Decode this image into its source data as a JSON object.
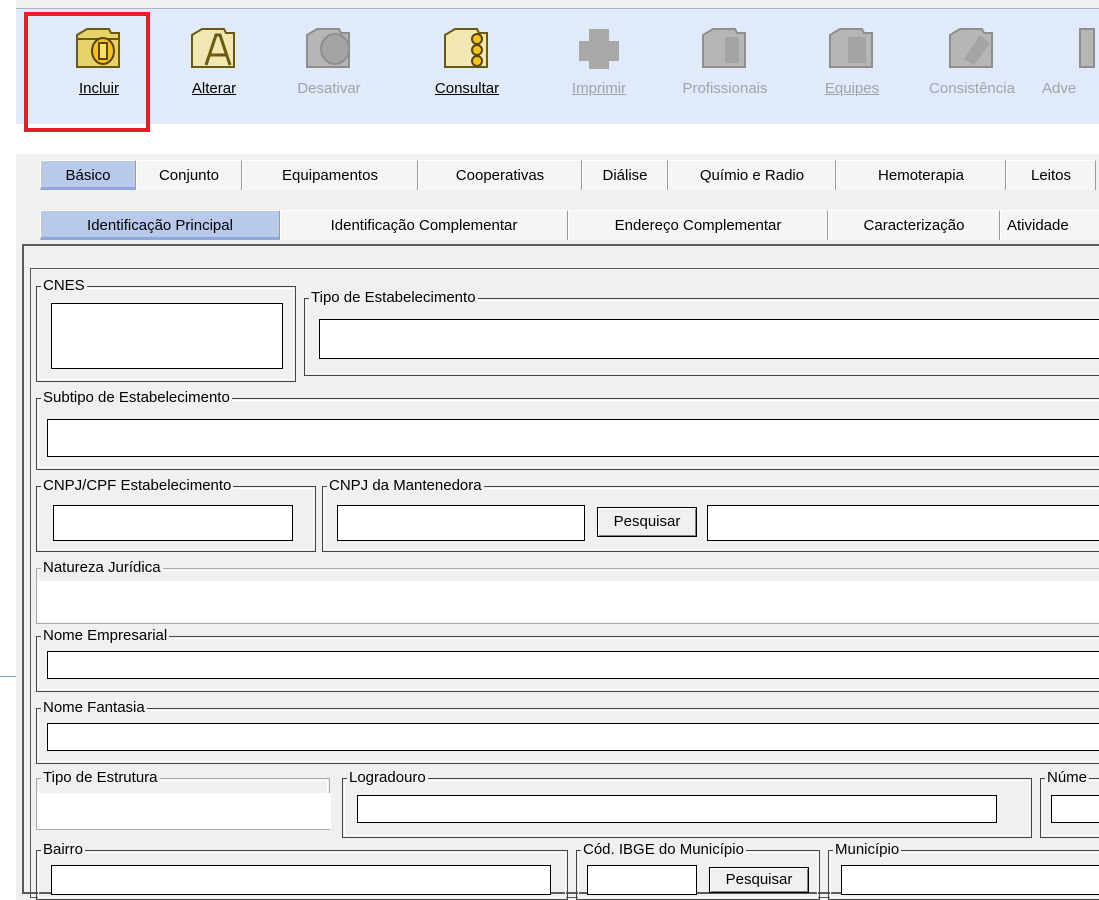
{
  "toolbar": {
    "buttons": [
      {
        "label": "Incluir",
        "enabled": true
      },
      {
        "label": "Alterar",
        "enabled": true
      },
      {
        "label": "Desativar",
        "enabled": false
      },
      {
        "label": "Consultar",
        "enabled": true
      },
      {
        "label": "Imprimir",
        "enabled": false
      },
      {
        "label": "Profissionais",
        "enabled": false
      },
      {
        "label": "Equipes",
        "enabled": false
      },
      {
        "label": "Consistência",
        "enabled": false
      },
      {
        "label": "Adve",
        "enabled": false
      }
    ]
  },
  "tabs_primary": [
    "Básico",
    "Conjunto",
    "Equipamentos",
    "Cooperativas",
    "Diálise",
    "Químio e Radio",
    "Hemoterapia",
    "Leitos"
  ],
  "tabs_primary_active": "Básico",
  "tabs_secondary": [
    "Identificação Principal",
    "Identificação Complementar",
    "Endereço Complementar",
    "Caracterização",
    "Atividade"
  ],
  "tabs_secondary_active": "Identificação Principal",
  "form": {
    "cnes": {
      "label": "CNES",
      "value": ""
    },
    "tipo_estabelecimento": {
      "label": "Tipo de Estabelecimento",
      "value": ""
    },
    "subtipo_estabelecimento": {
      "label": "Subtipo de Estabelecimento",
      "value": ""
    },
    "cnpj_cpf_estabelecimento": {
      "label": "CNPJ/CPF Estabelecimento",
      "value": ""
    },
    "cnpj_mantenedora": {
      "label": "CNPJ da Mantenedora",
      "value": "",
      "search_label": "Pesquisar",
      "name_value": ""
    },
    "natureza_juridica": {
      "label": "Natureza Jurídica",
      "value": ""
    },
    "nome_empresarial": {
      "label": "Nome Empresarial",
      "value": ""
    },
    "nome_fantasia": {
      "label": "Nome Fantasia",
      "value": ""
    },
    "tipo_estrutura": {
      "label": "Tipo de Estrutura",
      "value": ""
    },
    "logradouro": {
      "label": "Logradouro",
      "value": ""
    },
    "numero": {
      "label": "Núme",
      "value": ""
    },
    "bairro": {
      "label": "Bairro",
      "value": ""
    },
    "cod_ibge": {
      "label": "Cód. IBGE do Município",
      "value": "",
      "search_label": "Pesquisar"
    },
    "municipio": {
      "label": "Município",
      "value": ""
    }
  },
  "colors": {
    "toolbar_bg": "#e1eaf8",
    "tab_active": "#b8c9ec",
    "highlight": "#e41e24",
    "disabled_text": "#9ea4ad"
  }
}
